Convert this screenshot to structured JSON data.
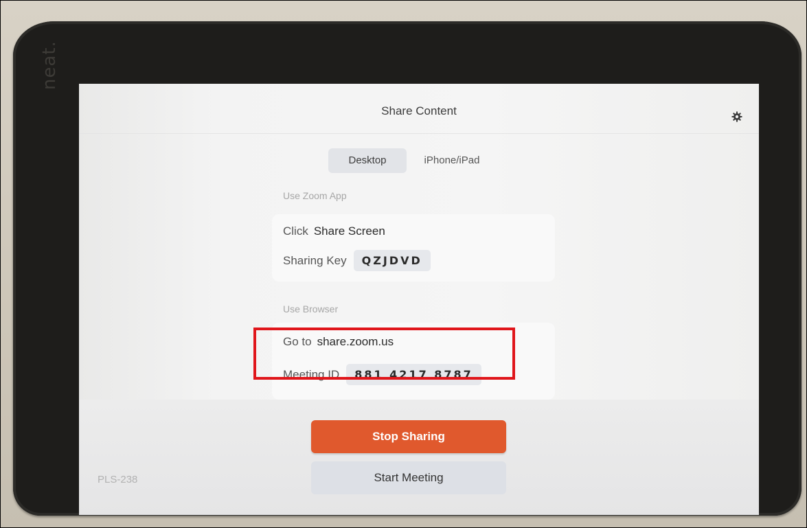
{
  "device": {
    "brand": "neat."
  },
  "screen": {
    "title": "Share Content",
    "settings_icon": "gear-icon",
    "tabs": [
      {
        "label": "Desktop",
        "active": true
      },
      {
        "label": "iPhone/iPad",
        "active": false
      }
    ],
    "zoom_app": {
      "section_label": "Use Zoom App",
      "click_prefix": "Click",
      "click_value": "Share Screen",
      "sharing_key_label": "Sharing Key",
      "sharing_key": "QZJDVD"
    },
    "browser": {
      "section_label": "Use Browser",
      "goto_prefix": "Go to",
      "goto_value": "share.zoom.us",
      "meeting_id_label": "Meeting ID",
      "meeting_id": "881 4217 8787"
    },
    "stop_sharing_label": "Stop Sharing",
    "start_meeting_label": "Start Meeting",
    "room_name": "PLS-238"
  },
  "colors": {
    "stop_button": "#e0592d",
    "highlight_box": "#e0161b",
    "bezel": "#1e1d1b"
  }
}
